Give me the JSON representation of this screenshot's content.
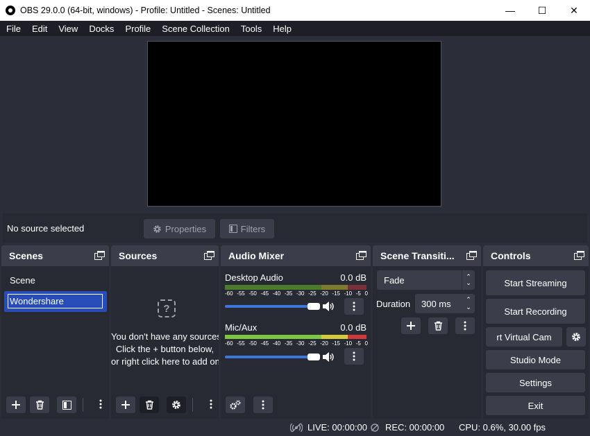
{
  "window": {
    "title": "OBS 29.0.0 (64-bit, windows) - Profile: Untitled - Scenes: Untitled",
    "minimize": "—",
    "maximize": "☐",
    "close": "✕"
  },
  "menu": [
    "File",
    "Edit",
    "View",
    "Docks",
    "Profile",
    "Scene Collection",
    "Tools",
    "Help"
  ],
  "source_toolbar": {
    "status": "No source selected",
    "properties_label": "Properties",
    "filters_label": "Filters"
  },
  "scenes": {
    "title": "Scenes",
    "items": [
      "Scene",
      "Wondershare"
    ],
    "selected": "Wondershare"
  },
  "sources": {
    "title": "Sources",
    "empty_lines": [
      "You don't have any sources.",
      "Click the + button below,",
      "or right click here to add one."
    ]
  },
  "audio_mixer": {
    "title": "Audio Mixer",
    "ticks": [
      "-60",
      "-55",
      "-50",
      "-45",
      "-40",
      "-35",
      "-30",
      "-25",
      "-20",
      "-15",
      "-10",
      "-5",
      "0"
    ],
    "channels": [
      {
        "name": "Desktop Audio",
        "level": "0.0 dB",
        "volume": 1.0
      },
      {
        "name": "Mic/Aux",
        "level": "0.0 dB",
        "volume": 1.0
      }
    ]
  },
  "transitions": {
    "title": "Scene Transiti...",
    "selected": "Fade",
    "duration_label": "Duration",
    "duration_value": "300 ms"
  },
  "controls": {
    "title": "Controls",
    "start_streaming": "Start Streaming",
    "start_recording": "Start Recording",
    "virtual_cam": "rt Virtual Cam",
    "studio_mode": "Studio Mode",
    "settings": "Settings",
    "exit": "Exit"
  },
  "status": {
    "live": "LIVE: 00:00:00",
    "rec": "REC: 00:00:00",
    "cpu": "CPU: 0.6%, 30.00 fps"
  },
  "colors": {
    "background": "#2b2e38",
    "dock": "#272a33",
    "header": "#3b3e4a",
    "selection": "#284cb8",
    "slider": "#3c78db"
  }
}
